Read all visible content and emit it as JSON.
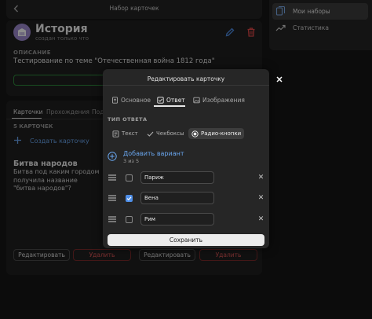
{
  "header": {
    "title": "Набор карточек"
  },
  "subject": {
    "title": "История",
    "subtitle": "создан только что",
    "description_label": "ОПИСАНИЕ",
    "description": "Тестирование по теме \"Отечественная война 1812 года\""
  },
  "tabs": [
    "Карточки",
    "Прохождения",
    "Под"
  ],
  "cards": {
    "count_label": "5 КАРТОЧЕК",
    "create_label": "Создать карточку",
    "items": [
      {
        "title": "Битва народов",
        "text": "Битва под каким городом получила название \"битва народов\"?"
      }
    ],
    "edit_label": "Редактировать",
    "delete_label": "Удалить"
  },
  "sidebar": {
    "items": [
      {
        "label": "Мои наборы",
        "icon": "cards-icon"
      },
      {
        "label": "Статистика",
        "icon": "chart-icon"
      }
    ]
  },
  "modal": {
    "title": "Редактировать карточку",
    "tabs": [
      {
        "label": "Основное",
        "icon": "document-icon"
      },
      {
        "label": "Ответ",
        "icon": "checkbox-icon"
      },
      {
        "label": "Изображения",
        "icon": "image-icon"
      }
    ],
    "answer_type_label": "ТИП ОТВЕТА",
    "answer_types": [
      {
        "label": "Текст",
        "icon": "text-icon"
      },
      {
        "label": "Чекбоксы",
        "icon": "checkmark-icon"
      },
      {
        "label": "Радио-кнопки",
        "icon": "radio-icon"
      }
    ],
    "selected_answer_type": "Радио-кнопки",
    "add_variant_label": "Добавить вариант",
    "variant_count": "3 из 5",
    "options": [
      {
        "value": "Париж",
        "checked": false
      },
      {
        "value": "Вена",
        "checked": true
      },
      {
        "value": "Рим",
        "checked": false
      }
    ],
    "save_label": "Сохранить"
  },
  "colors": {
    "accent_blue": "#6aa7f0",
    "danger": "#e05757",
    "success": "#2f8a3c",
    "avatar": "#9e8bd0"
  }
}
